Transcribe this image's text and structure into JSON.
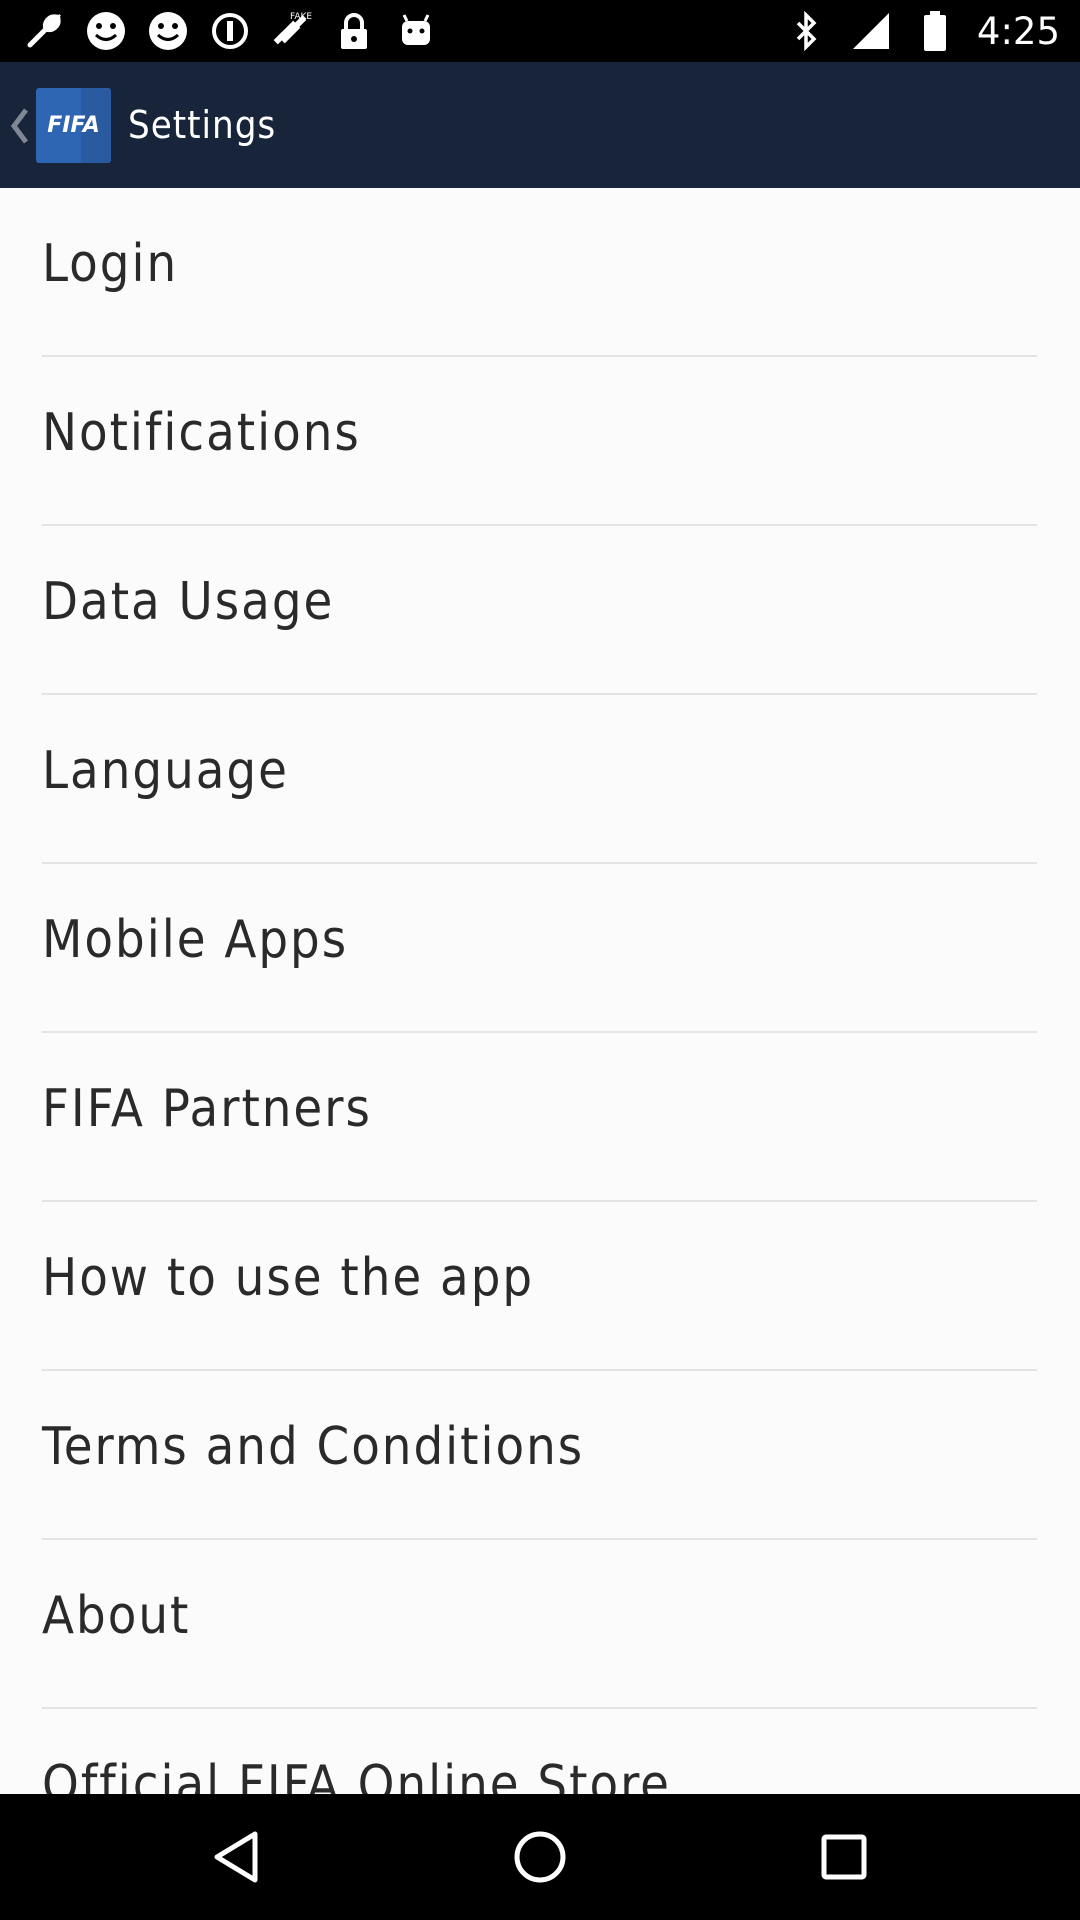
{
  "status_bar": {
    "time": "4:25",
    "left_icons": [
      "wrench-icon",
      "smiley-icon",
      "smiley-icon",
      "info-circle-icon",
      "fake-gps-icon",
      "lock-icon",
      "android-icon"
    ],
    "right_icons": [
      "bluetooth-icon",
      "signal-icon",
      "battery-icon"
    ]
  },
  "app_bar": {
    "logo_text": "FIFA",
    "title": "Settings"
  },
  "menu": {
    "items": [
      {
        "label": "Login"
      },
      {
        "label": "Notifications"
      },
      {
        "label": "Data Usage"
      },
      {
        "label": "Language"
      },
      {
        "label": "Mobile Apps"
      },
      {
        "label": "FIFA Partners"
      },
      {
        "label": "How to use the app"
      },
      {
        "label": "Terms and Conditions"
      },
      {
        "label": "About"
      },
      {
        "label": "Official FIFA Online Store"
      }
    ]
  },
  "nav_bar": {
    "buttons": [
      "back-triangle-icon",
      "home-circle-icon",
      "recents-square-icon"
    ]
  },
  "colors": {
    "app_bar": "#17243a",
    "logo": "#2f66b3",
    "background": "#fbfbfb",
    "divider": "#e4e4e4"
  }
}
